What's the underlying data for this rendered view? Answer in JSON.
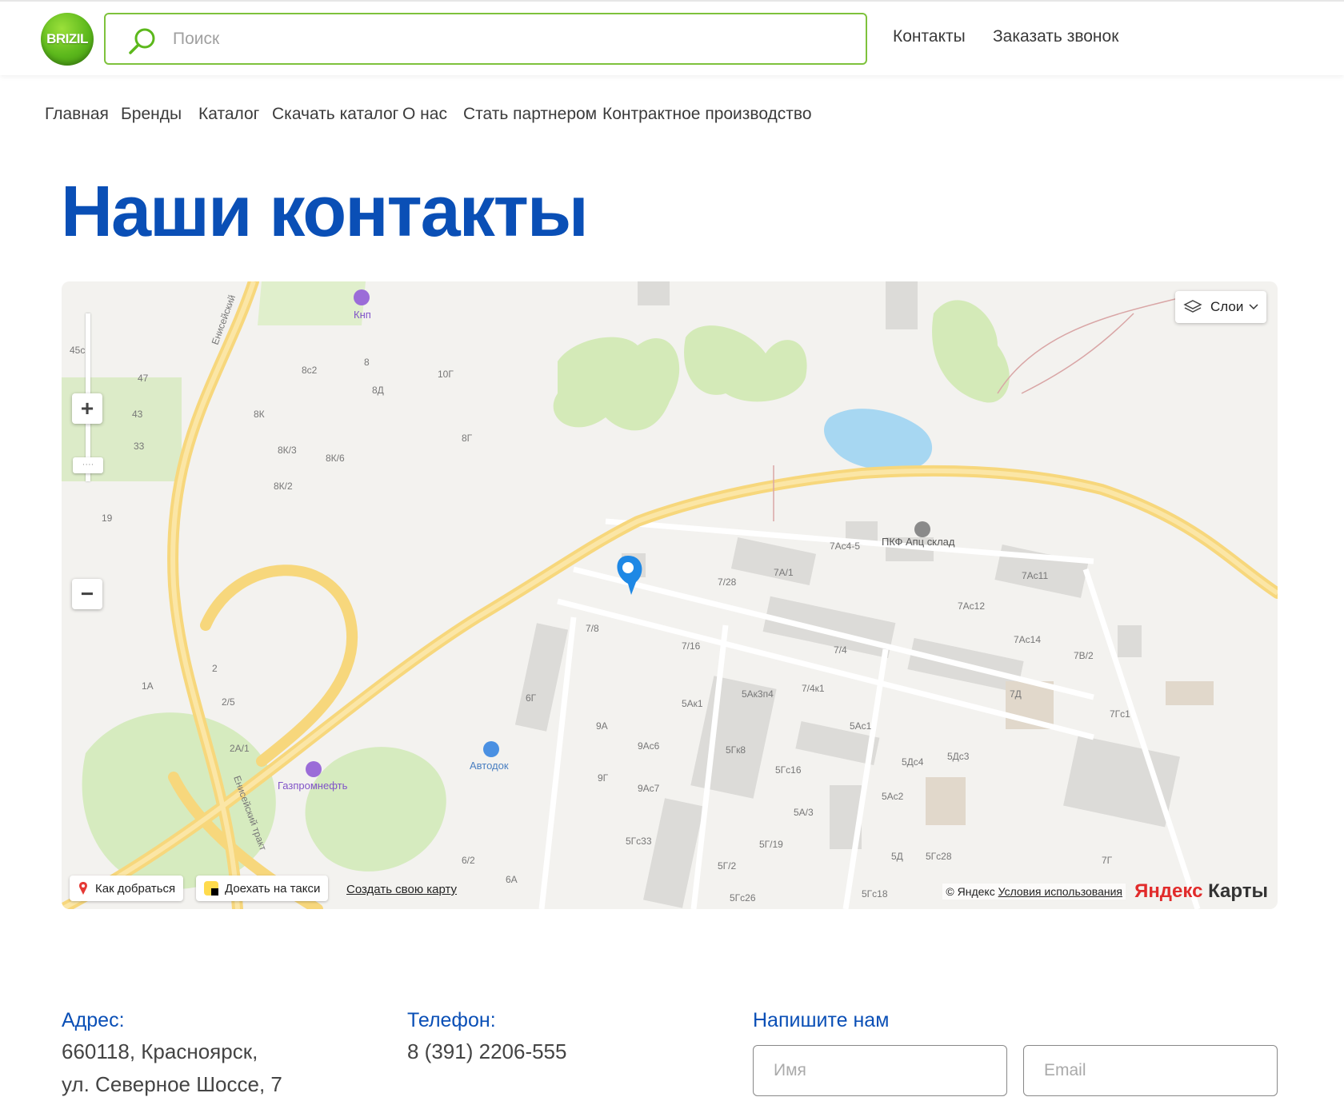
{
  "header": {
    "logo_text": "BRIZIL",
    "search_placeholder": "Поиск",
    "links": [
      "Контакты",
      "Заказать звонок"
    ]
  },
  "nav": {
    "items": [
      "Главная",
      "Бренды",
      "Каталог",
      "Скачать каталог",
      "О нас",
      "Стать партнером",
      "Контрактное производство"
    ]
  },
  "page": {
    "title": "Наши контакты"
  },
  "map": {
    "layers_label": "Слои",
    "zoom_in": "+",
    "zoom_out": "−",
    "route_label": "Как добраться",
    "taxi_label": "Доехать на такси",
    "create_map_label": "Создать свою карту",
    "copyright": "© Яндекс",
    "terms_label": "Условия использования",
    "brand": {
      "part1": "Яндекс",
      "part2": " Карты"
    },
    "pois": [
      "Кнп",
      "ПКФ Апц склад",
      "Автодок",
      "Газпромнефть"
    ],
    "road_labels": [
      "Енисейский",
      "Енисейский тракт"
    ],
    "building_labels": [
      "45с2",
      "47",
      "43",
      "33",
      "19",
      "8с2",
      "8",
      "8Д",
      "8К",
      "8К/3",
      "8К/6",
      "8К/2",
      "10Г",
      "8Г",
      "7Ас4-5",
      "7А/1",
      "7/28",
      "7Ас11",
      "7Ас12",
      "7Ас14",
      "7/8",
      "7/16",
      "7/4",
      "7/4к1",
      "7Д",
      "7В/2",
      "1А",
      "2",
      "2/5",
      "2А/1",
      "6Г",
      "5Ак1",
      "5Ак3п4",
      "9А",
      "9Ас6",
      "5Гк8",
      "5Ас1",
      "5Дс4",
      "5Дс3",
      "9Г",
      "9Ас7",
      "5Гс16",
      "5Ас2",
      "5А/3",
      "5Гс33",
      "5Г/19",
      "5Д",
      "5Гс28",
      "5Г/2",
      "6/2",
      "6А",
      "5Гс26",
      "5Гс18",
      "7Гс1",
      "7Г"
    ]
  },
  "contacts": {
    "address_label": "Адрес:",
    "address_line1": "660118, Красноярск,",
    "address_line2": "ул. Северное Шоссе, 7",
    "phone_label": "Телефон:",
    "phone": "8 (391) 2206-555",
    "form_label": "Напишите нам",
    "name_placeholder": "Имя",
    "email_placeholder": "Email"
  }
}
